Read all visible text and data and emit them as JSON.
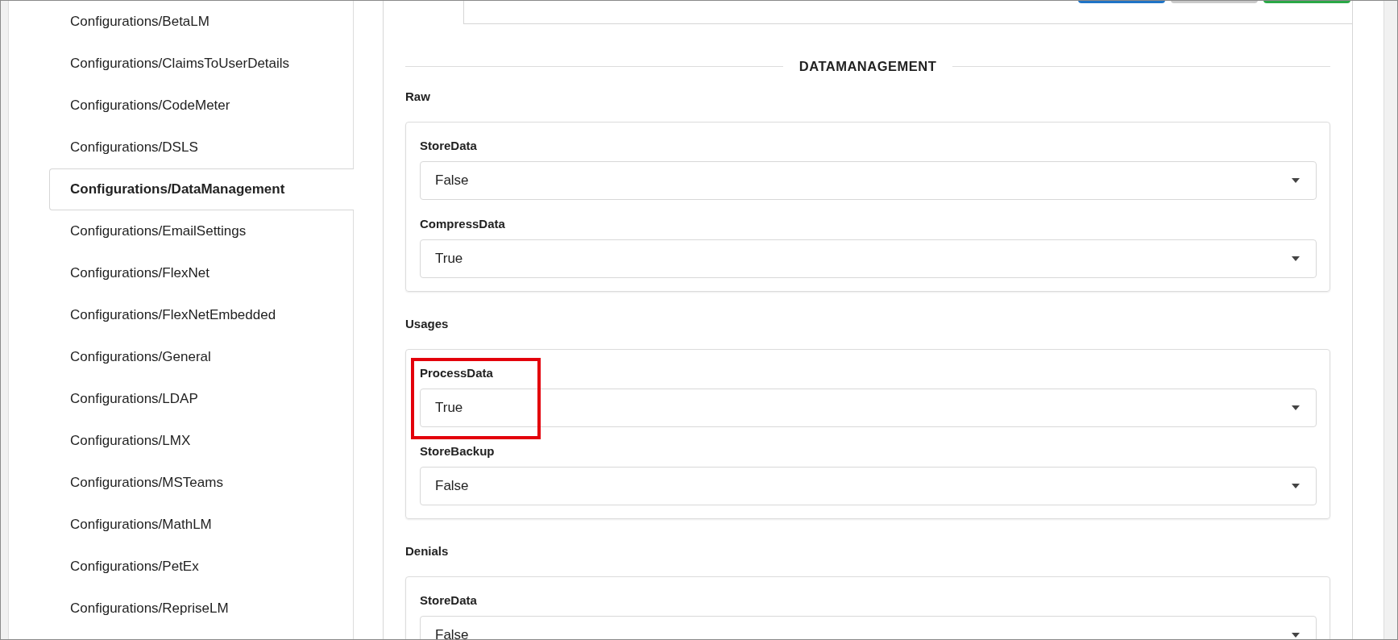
{
  "sidebar": {
    "items": [
      {
        "label": "Configurations/BetaLM",
        "selected": false
      },
      {
        "label": "Configurations/ClaimsToUserDetails",
        "selected": false
      },
      {
        "label": "Configurations/CodeMeter",
        "selected": false
      },
      {
        "label": "Configurations/DSLS",
        "selected": false
      },
      {
        "label": "Configurations/DataManagement",
        "selected": true
      },
      {
        "label": "Configurations/EmailSettings",
        "selected": false
      },
      {
        "label": "Configurations/FlexNet",
        "selected": false
      },
      {
        "label": "Configurations/FlexNetEmbedded",
        "selected": false
      },
      {
        "label": "Configurations/General",
        "selected": false
      },
      {
        "label": "Configurations/LDAP",
        "selected": false
      },
      {
        "label": "Configurations/LMX",
        "selected": false
      },
      {
        "label": "Configurations/MSTeams",
        "selected": false
      },
      {
        "label": "Configurations/MathLM",
        "selected": false
      },
      {
        "label": "Configurations/PetEx",
        "selected": false
      },
      {
        "label": "Configurations/RepriseLM",
        "selected": false
      }
    ]
  },
  "toolbar": {
    "buttons": [
      {
        "color": "#1f74c6"
      },
      {
        "color": "#c9c9c9"
      },
      {
        "color": "#2aa846"
      }
    ]
  },
  "panel": {
    "heading": "DATAMANAGEMENT",
    "sections": [
      {
        "title": "Raw",
        "fields": [
          {
            "label": "StoreData",
            "value": "False",
            "highlighted": false
          },
          {
            "label": "CompressData",
            "value": "True",
            "highlighted": false
          }
        ]
      },
      {
        "title": "Usages",
        "fields": [
          {
            "label": "ProcessData",
            "value": "True",
            "highlighted": true
          },
          {
            "label": "StoreBackup",
            "value": "False",
            "highlighted": false
          }
        ]
      },
      {
        "title": "Denials",
        "fields": [
          {
            "label": "StoreData",
            "value": "False",
            "highlighted": false
          }
        ]
      }
    ]
  }
}
